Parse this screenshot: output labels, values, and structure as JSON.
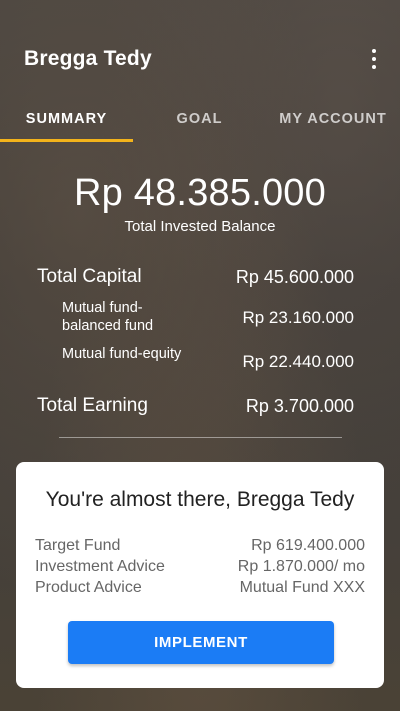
{
  "header": {
    "title": "Bregga Tedy",
    "menu_icon": "more-vert-icon"
  },
  "tabs": [
    {
      "label": "SUMMARY",
      "active": true
    },
    {
      "label": "GOAL",
      "active": false
    },
    {
      "label": "MY ACCOUNT",
      "active": false
    }
  ],
  "summary": {
    "total_balance": "Rp 48.385.000",
    "total_balance_label": "Total Invested Balance",
    "rows": [
      {
        "label": "Total Capital",
        "value": "Rp 45.600.000"
      },
      {
        "label": "Mutual fund-balanced fund",
        "value": "Rp 23.160.000"
      },
      {
        "label": "Mutual fund-equity",
        "value": "Rp 22.440.000"
      },
      {
        "label": "Total Earning",
        "value": "Rp 3.700.000"
      }
    ]
  },
  "card": {
    "title": "You're almost there, Bregga Tedy",
    "rows": [
      {
        "label": "Target Fund",
        "value": "Rp 619.400.000"
      },
      {
        "label": "Investment Advice",
        "value": "Rp 1.870.000/ mo"
      },
      {
        "label": "Product Advice",
        "value": "Mutual Fund XXX"
      }
    ],
    "button_label": "IMPLEMENT"
  },
  "colors": {
    "accent": "#f3b31b",
    "button": "#1b7cf5",
    "card_bg": "#ffffff"
  }
}
